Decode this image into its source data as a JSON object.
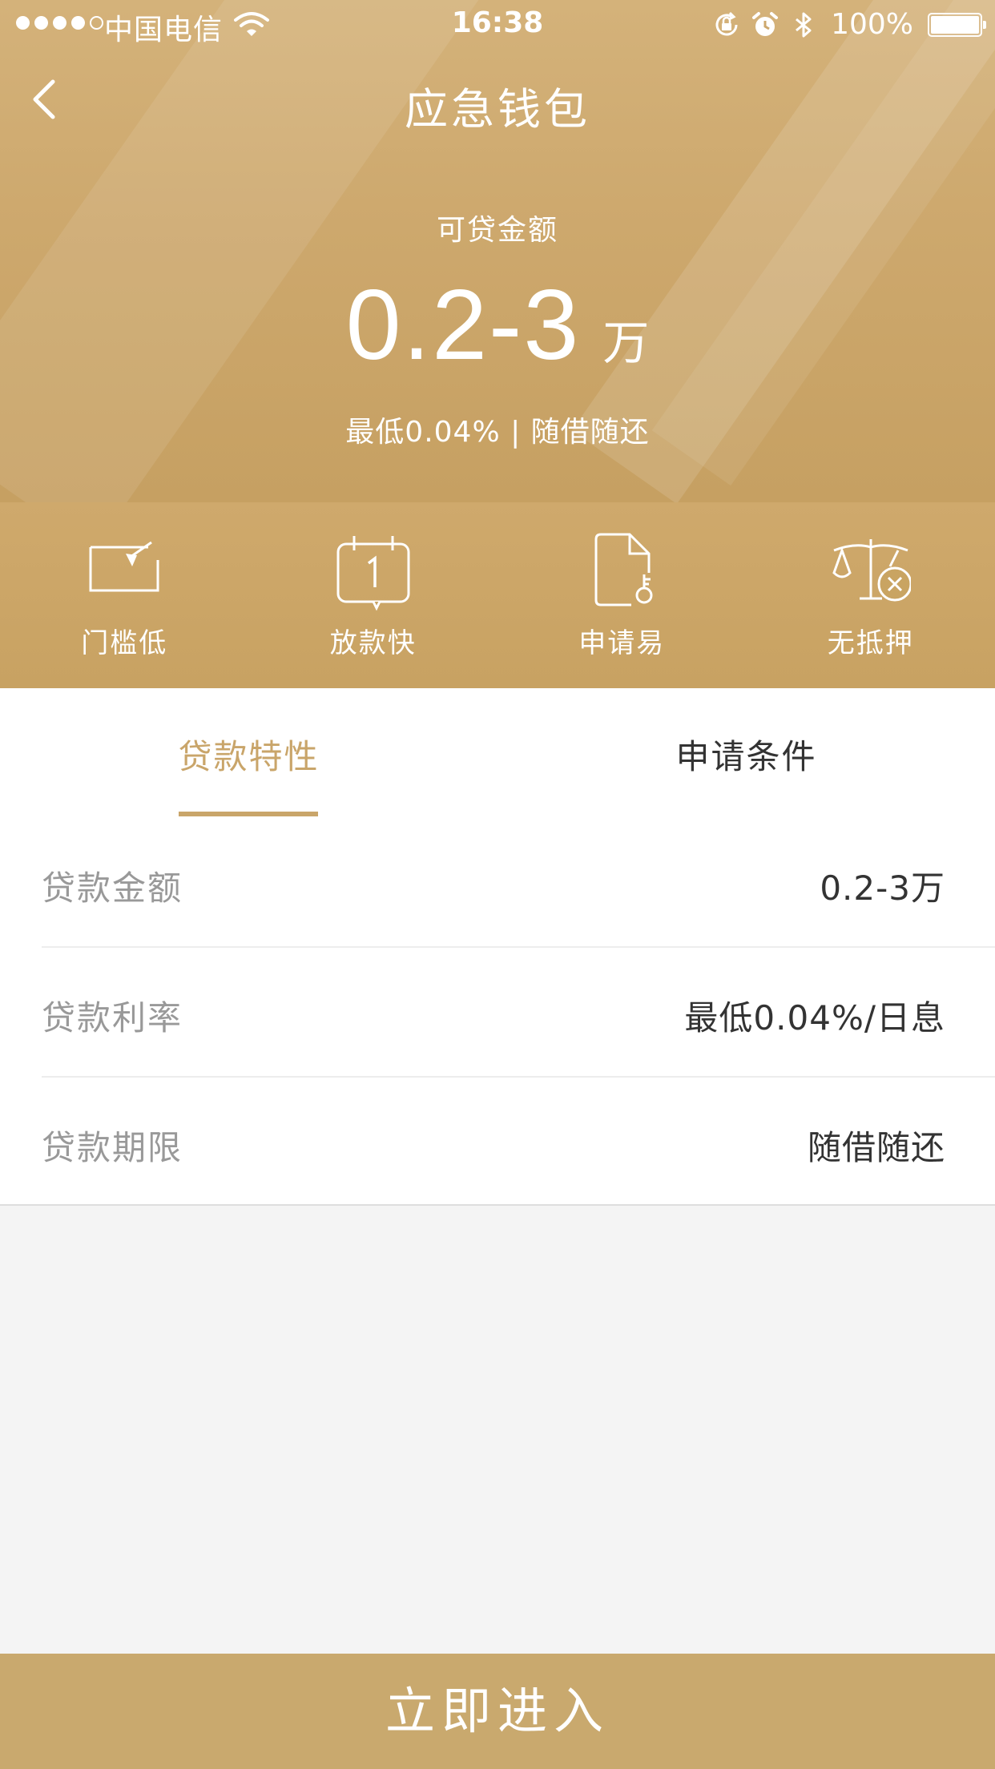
{
  "status_bar": {
    "carrier": "中国电信",
    "time": "16:38",
    "battery": "100%"
  },
  "nav": {
    "title": "应急钱包"
  },
  "hero": {
    "label": "可贷金额",
    "amount": "0.2-3",
    "unit": "万",
    "subtitle": "最低0.04% | 随借随还"
  },
  "features": [
    {
      "label": "门槛低",
      "icon": "low-threshold-icon"
    },
    {
      "label": "放款快",
      "icon": "calendar-icon"
    },
    {
      "label": "申请易",
      "icon": "document-key-icon"
    },
    {
      "label": "无抵押",
      "icon": "scale-no-collateral-icon"
    }
  ],
  "tabs": [
    {
      "label": "贷款特性",
      "active": true
    },
    {
      "label": "申请条件",
      "active": false
    }
  ],
  "rows": [
    {
      "label": "贷款金额",
      "value": "0.2-3万"
    },
    {
      "label": "贷款利率",
      "value": "最低0.04%/日息"
    },
    {
      "label": "贷款期限",
      "value": "随借随还"
    }
  ],
  "button": {
    "label": "立即进入"
  },
  "colors": {
    "gold": "#c9a56a",
    "gold_header": "#cda86d",
    "button": "#c9a96e",
    "text_dark": "#333333",
    "text_gray": "#999999",
    "background": "#f4f4f4"
  }
}
